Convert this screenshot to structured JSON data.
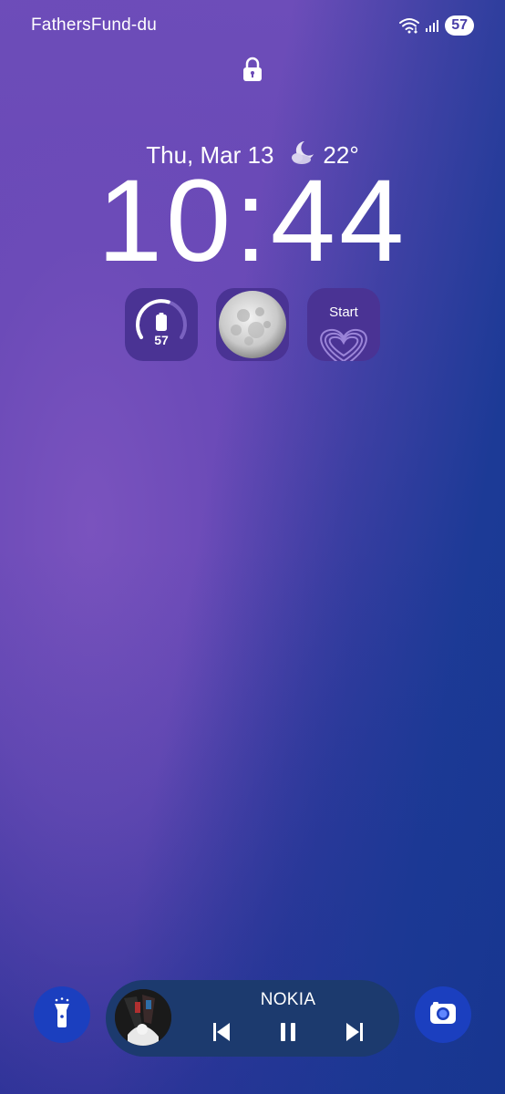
{
  "status_bar": {
    "carrier": "FathersFund-du",
    "battery": "57",
    "icons": [
      "wifi-icon",
      "signal-icon",
      "battery-icon"
    ]
  },
  "lock": {
    "icon": "lock-icon"
  },
  "date": "Thu, Mar 13",
  "weather": {
    "icon": "moon-cloud-icon",
    "temperature": "22°"
  },
  "clock": "10:44",
  "widgets": {
    "battery": {
      "value": "57",
      "level": 0.57,
      "icon": "phone-battery-icon"
    },
    "moon": {
      "icon": "full-moon-icon"
    },
    "start": {
      "label": "Start",
      "icon": "heart-icon"
    }
  },
  "bottom_bar": {
    "left_shortcut_icon": "flashlight-icon",
    "right_shortcut_icon": "camera-icon",
    "media": {
      "title": "NOKIA",
      "controls": [
        "previous-icon",
        "pause-icon",
        "next-icon"
      ]
    }
  },
  "colors": {
    "background_purple": "#6c4bb8",
    "background_blue": "#1c3a96",
    "widget_bg": "#4a3394",
    "shortcut_bg": "#1b3fbf",
    "media_bg": "#1c3a6e"
  }
}
